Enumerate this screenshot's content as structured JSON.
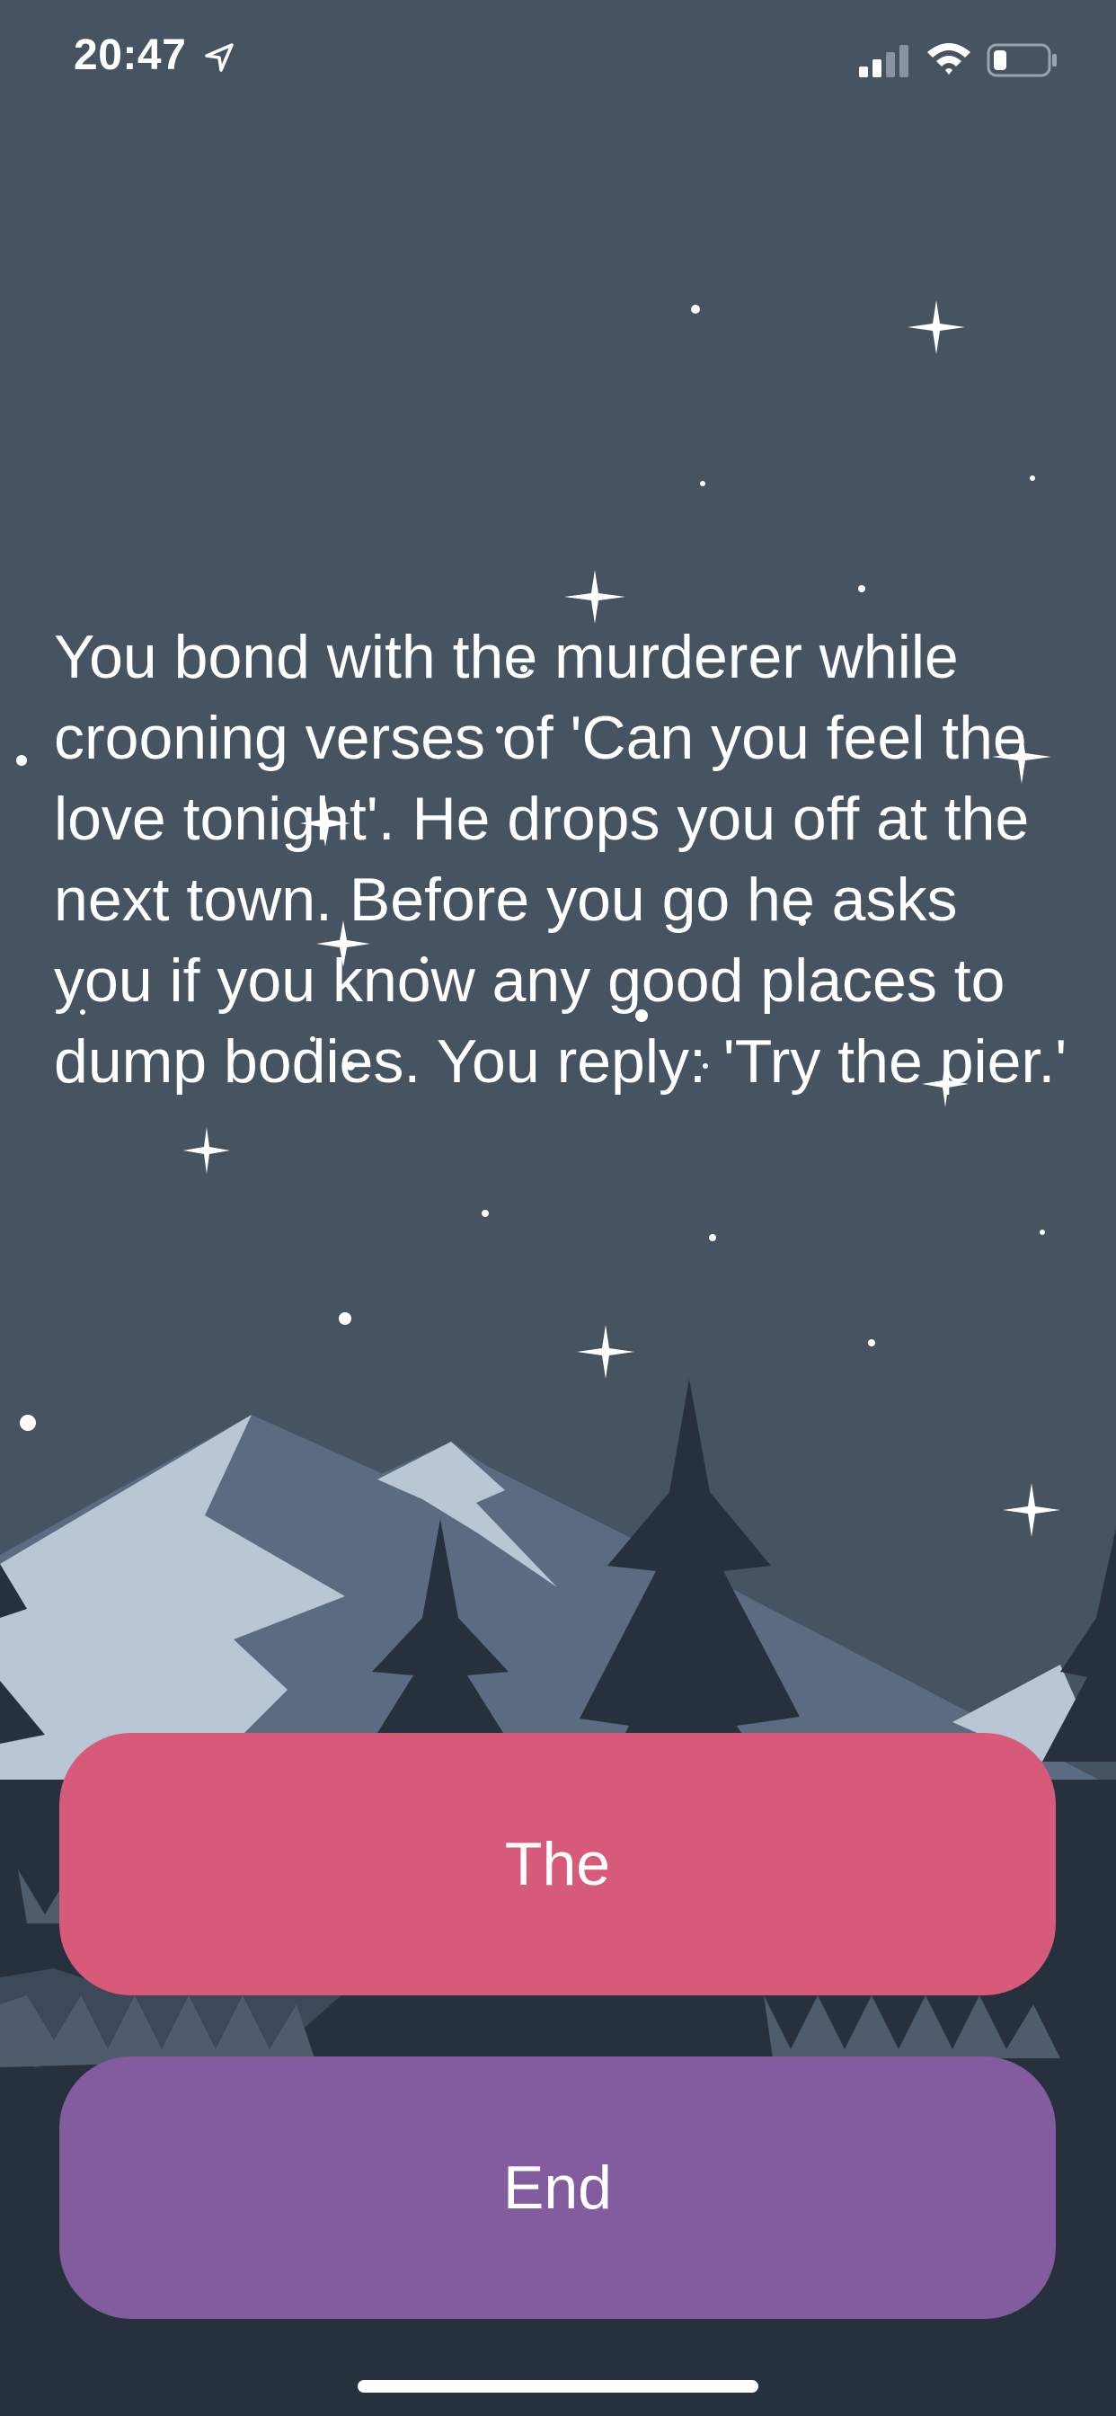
{
  "status_bar": {
    "time": "20:47",
    "icons": [
      "location-arrow-icon",
      "cellular-signal-icon",
      "wifi-icon",
      "battery-icon"
    ]
  },
  "story": {
    "text": "You bond with the murderer while crooning verses of 'Can you feel the love tonight'. He drops you off at the next town. Before you go he asks you if you know any good places to dump bodies. You reply: 'Try the pier.'"
  },
  "choices": [
    {
      "label": "The",
      "color": "#d75a7b"
    },
    {
      "label": "End",
      "color": "#825c9f"
    }
  ],
  "theme": {
    "sky": "#465361",
    "mountain_far": "#5a6b82",
    "snow": "#b9c6d3",
    "tree_dark": "#27313d",
    "tree_mid": "#3c4958"
  }
}
